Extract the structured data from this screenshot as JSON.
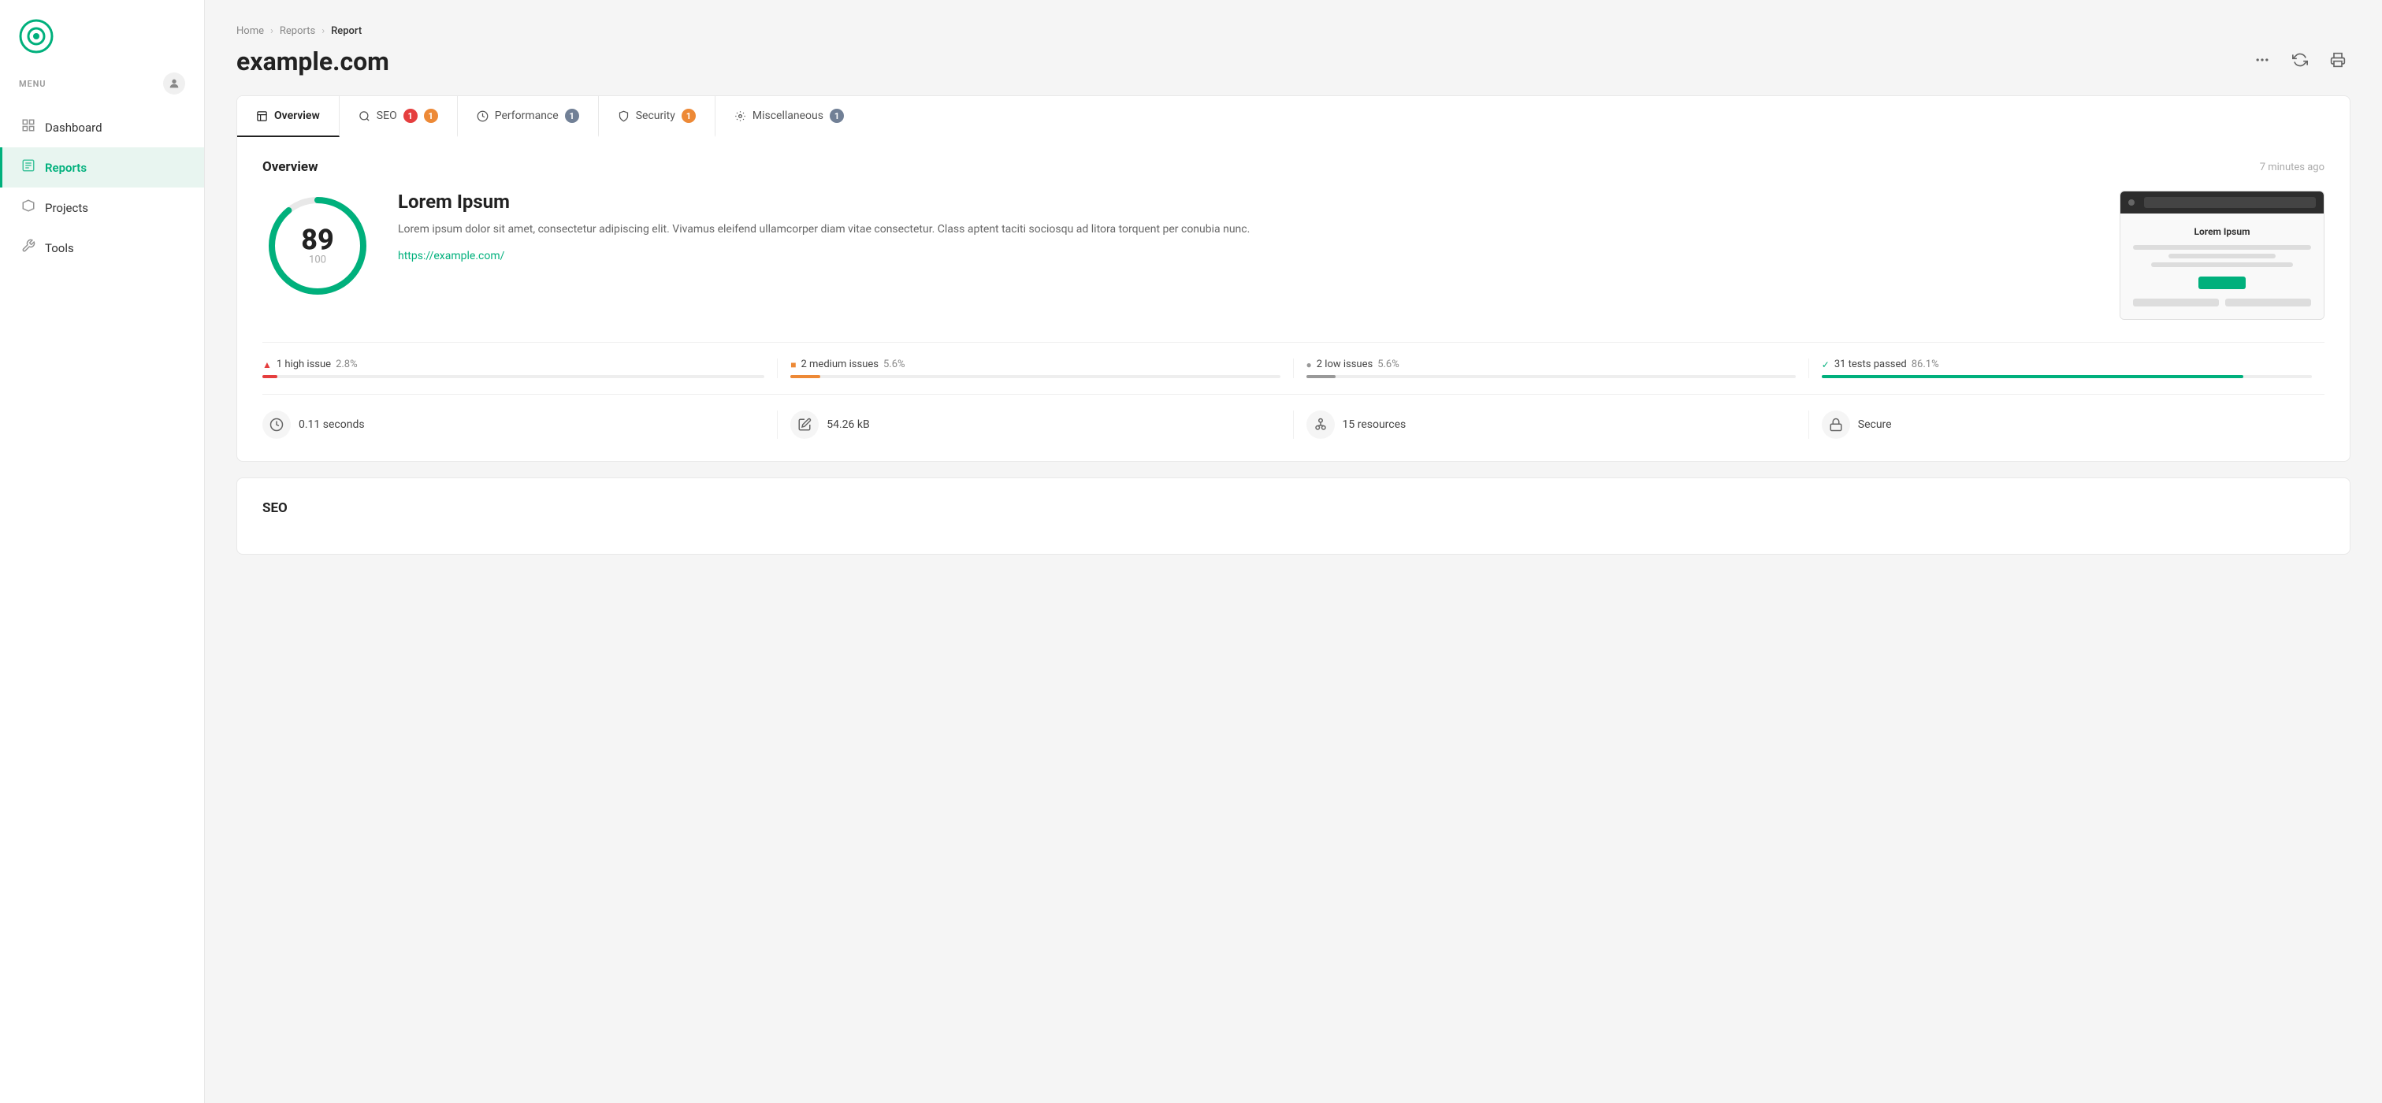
{
  "sidebar": {
    "menu_label": "MENU",
    "nav_items": [
      {
        "id": "dashboard",
        "label": "Dashboard",
        "icon": "⊞",
        "active": false
      },
      {
        "id": "reports",
        "label": "Reports",
        "icon": "☰",
        "active": true
      },
      {
        "id": "projects",
        "label": "Projects",
        "icon": "◇",
        "active": false
      },
      {
        "id": "tools",
        "label": "Tools",
        "icon": "✂",
        "active": false
      }
    ]
  },
  "breadcrumb": {
    "items": [
      "Home",
      "Reports",
      "Report"
    ]
  },
  "page": {
    "title": "example.com",
    "actions": {
      "more": "...",
      "refresh": "↺",
      "print": "⎙"
    }
  },
  "tabs": [
    {
      "id": "overview",
      "label": "Overview",
      "icon": "overview",
      "badge": null,
      "active": true
    },
    {
      "id": "seo",
      "label": "SEO",
      "icon": "seo",
      "badge": [
        "red:1",
        "orange:1"
      ],
      "active": false
    },
    {
      "id": "performance",
      "label": "Performance",
      "icon": "performance",
      "badge": [
        "gray:1"
      ],
      "active": false
    },
    {
      "id": "security",
      "label": "Security",
      "icon": "security",
      "badge": [
        "orange:1"
      ],
      "active": false
    },
    {
      "id": "miscellaneous",
      "label": "Miscellaneous",
      "icon": "misc",
      "badge": [
        "gray:1"
      ],
      "active": false
    }
  ],
  "overview": {
    "title": "Overview",
    "timestamp": "7 minutes ago",
    "score": {
      "value": 89,
      "max": 100,
      "percent": 89
    },
    "site": {
      "name": "Lorem Ipsum",
      "description": "Lorem ipsum dolor sit amet, consectetur adipiscing elit. Vivamus eleifend ullamcorper diam vitae consectetur. Class aptent taciti sociosqu ad litora torquent per conubia nunc.",
      "url": "https://example.com/"
    },
    "thumbnail": {
      "title": "Lorem Ipsum",
      "url_bar": ""
    },
    "issues": [
      {
        "id": "high",
        "label": "1 high issue",
        "pct": "2.8%",
        "color": "#e53e3e",
        "fill_width": "3%",
        "icon": "▲"
      },
      {
        "id": "medium",
        "label": "2 medium issues",
        "pct": "5.6%",
        "color": "#ed8936",
        "fill_width": "6%",
        "icon": "■"
      },
      {
        "id": "low",
        "label": "2 low issues",
        "pct": "5.6%",
        "color": "#999",
        "fill_width": "6%",
        "icon": "●"
      },
      {
        "id": "passed",
        "label": "31 tests passed",
        "pct": "86.1%",
        "color": "#00b07c",
        "fill_width": "86%",
        "icon": "✓"
      }
    ],
    "stats": [
      {
        "id": "speed",
        "icon": "⏱",
        "label": "0.11 seconds"
      },
      {
        "id": "size",
        "icon": "⚖",
        "label": "54.26 kB"
      },
      {
        "id": "resources",
        "icon": "⚙",
        "label": "15 resources"
      },
      {
        "id": "secure",
        "icon": "🔒",
        "label": "Secure"
      }
    ]
  },
  "seo_section": {
    "title": "SEO"
  }
}
